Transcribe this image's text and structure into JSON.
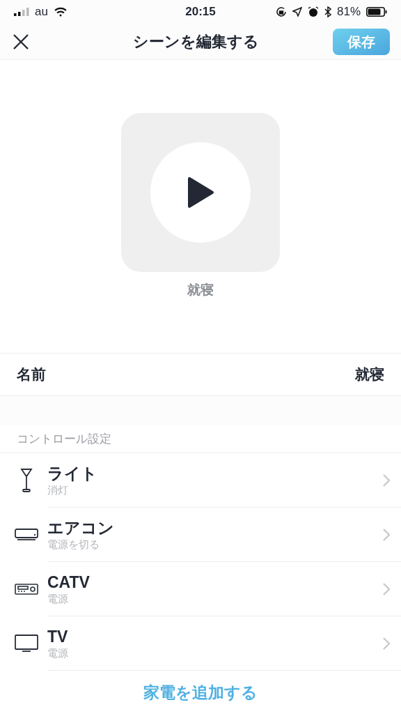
{
  "status_bar": {
    "carrier": "au",
    "time": "20:15",
    "battery": "81%"
  },
  "nav": {
    "title": "シーンを編集する",
    "save": "保存"
  },
  "scene": {
    "caption": "就寝"
  },
  "name_row": {
    "label": "名前",
    "value": "就寝"
  },
  "section": {
    "title": "コントロール設定"
  },
  "devices": [
    {
      "kind": "light",
      "name": "ライト",
      "action": "消灯"
    },
    {
      "kind": "aircon",
      "name": "エアコン",
      "action": "電源を切る"
    },
    {
      "kind": "tuner",
      "name": "CATV",
      "action": "電源"
    },
    {
      "kind": "tv",
      "name": "TV",
      "action": "電源"
    }
  ],
  "add_button": "家電を追加する"
}
